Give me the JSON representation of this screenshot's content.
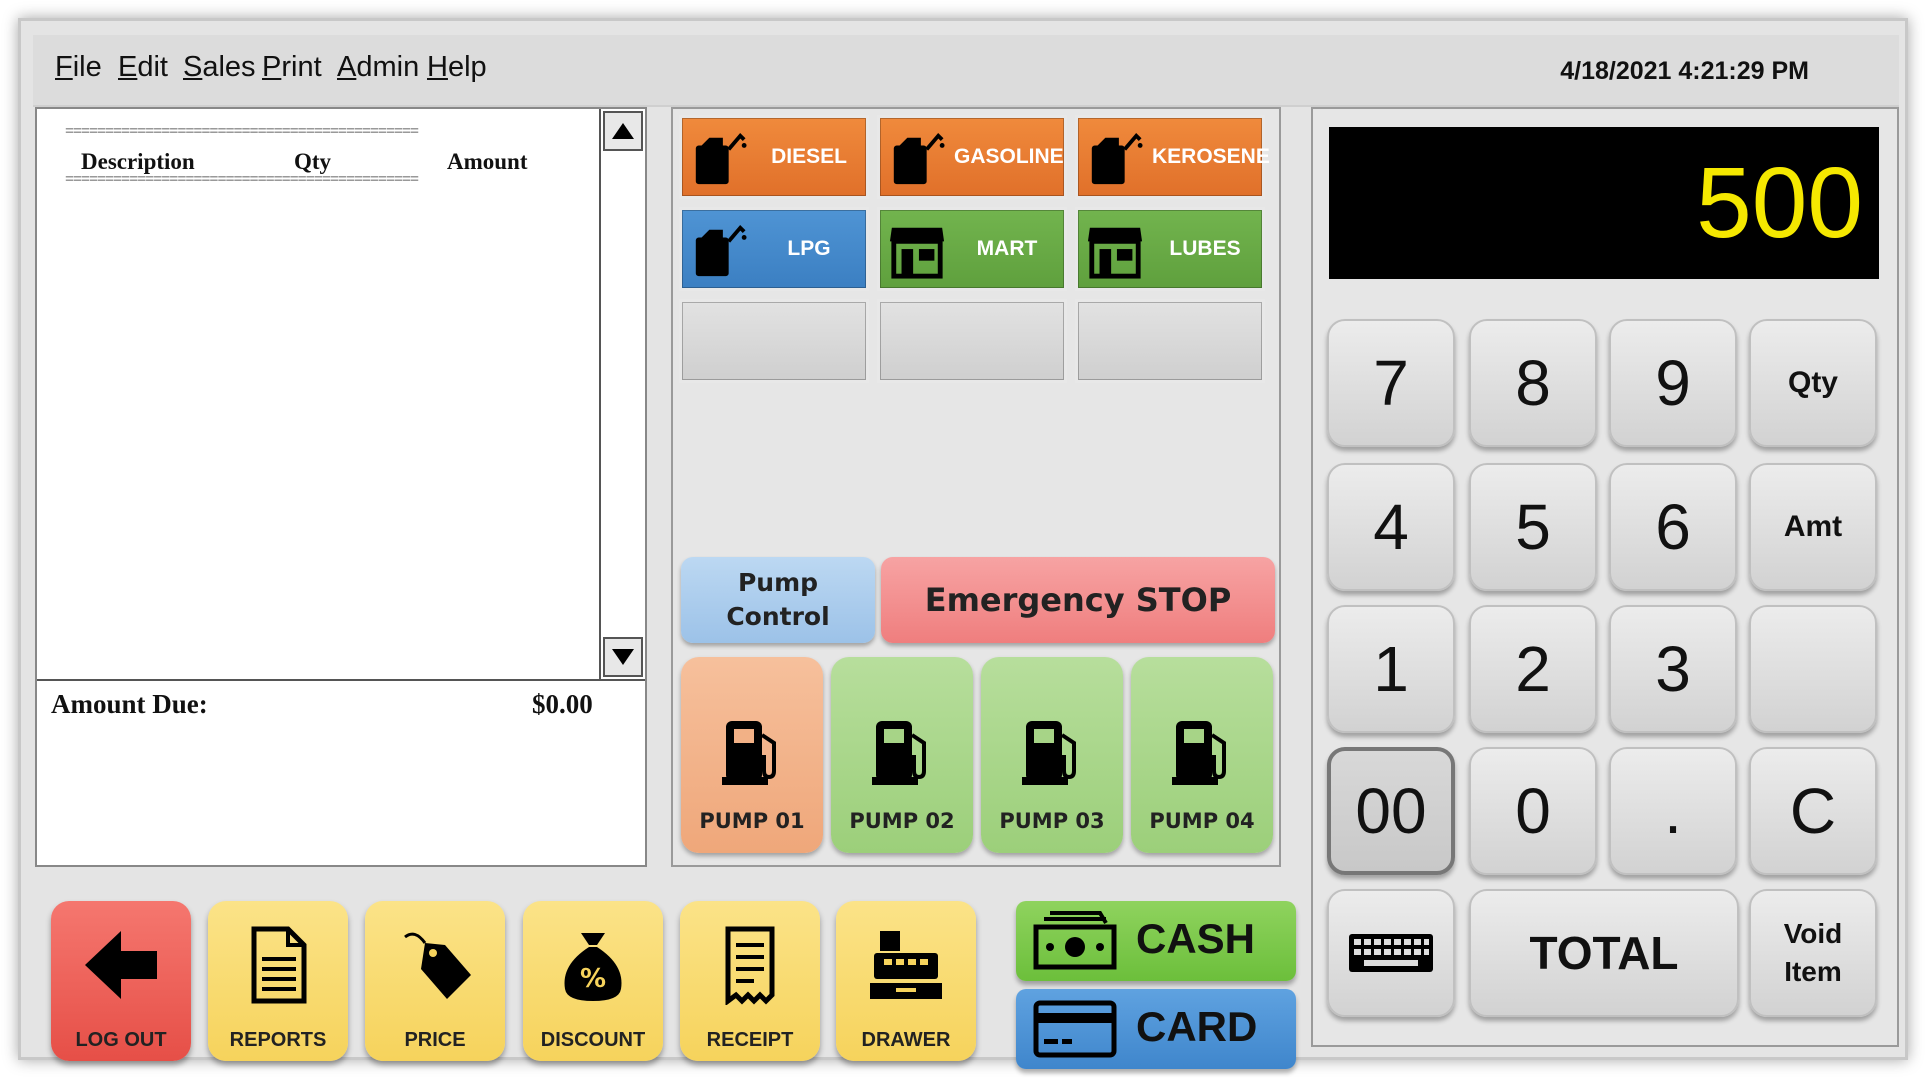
{
  "menu": {
    "items": [
      {
        "first": "F",
        "rest": "ile"
      },
      {
        "first": "E",
        "rest": "dit"
      },
      {
        "first": "S",
        "rest": "ales"
      },
      {
        "first": "P",
        "rest": "rint"
      },
      {
        "first": "A",
        "rest": "dmin"
      },
      {
        "first": "H",
        "rest": "elp"
      }
    ],
    "datetime": "4/18/2021 4:21:29 PM"
  },
  "receipt": {
    "separator": "============================================",
    "columns": {
      "description": "Description",
      "qty": "Qty",
      "amount": "Amount"
    },
    "amount_due_label": "Amount Due:",
    "amount_due_value": "$0.00"
  },
  "products": [
    {
      "label": "DIESEL",
      "color": "#e9782f",
      "icon": "fuel-can-icon"
    },
    {
      "label": "GASOLINE",
      "color": "#e9782f",
      "icon": "fuel-can-icon"
    },
    {
      "label": "KEROSENE",
      "color": "#e9782f",
      "icon": "fuel-can-icon"
    },
    {
      "label": "LPG",
      "color": "#4589cc",
      "icon": "fuel-can-icon"
    },
    {
      "label": "MART",
      "color": "#67aa45",
      "icon": "store-icon"
    },
    {
      "label": "LUBES",
      "color": "#67aa45",
      "icon": "store-icon"
    }
  ],
  "controls": {
    "pump_control_line1": "Pump",
    "pump_control_line2": "Control",
    "emergency": "Emergency STOP"
  },
  "pumps": [
    {
      "label": "PUMP 01",
      "color": "#f2b186",
      "status": "active"
    },
    {
      "label": "PUMP 02",
      "color": "#a7d487"
    },
    {
      "label": "PUMP 03",
      "color": "#a7d487"
    },
    {
      "label": "PUMP 04",
      "color": "#a7d487"
    }
  ],
  "display": {
    "value": "500",
    "color": "#f5e800"
  },
  "keypad": {
    "k7": "7",
    "k8": "8",
    "k9": "9",
    "qty": "Qty",
    "k4": "4",
    "k5": "5",
    "k6": "6",
    "amt": "Amt",
    "k1": "1",
    "k2": "2",
    "k3": "3",
    "k00": "00",
    "k0": "0",
    "dot": ".",
    "clear": "C",
    "total": "TOTAL",
    "void1": "Void",
    "void2": "Item"
  },
  "bottom": {
    "logout": "LOG OUT",
    "reports": "REPORTS",
    "price": "PRICE",
    "discount": "DISCOUNT",
    "receipt": "RECEIPT",
    "drawer": "DRAWER",
    "cash": "CASH",
    "card": "CARD"
  }
}
